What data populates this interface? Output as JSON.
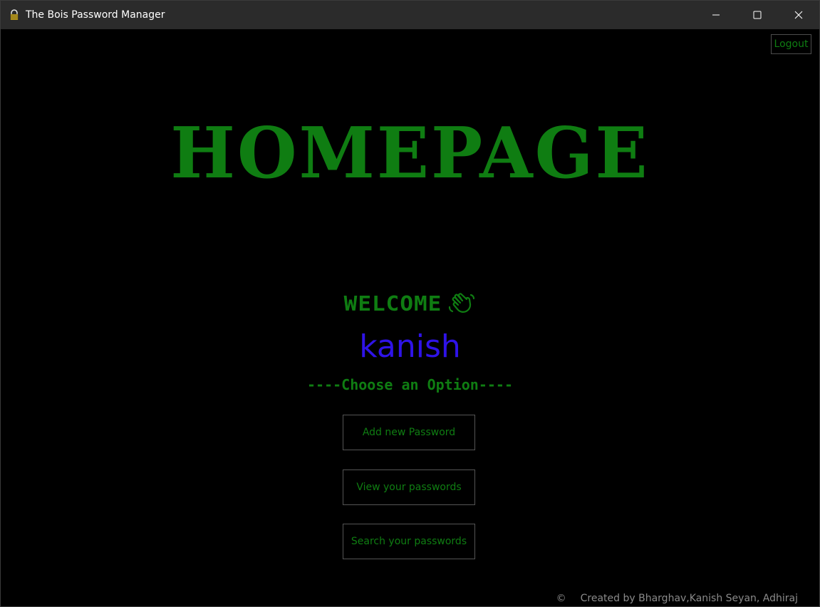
{
  "window": {
    "title": "The Bois Password Manager",
    "icon": "lock-icon"
  },
  "header": {
    "logout_label": "Logout"
  },
  "main": {
    "heading": "HOMEPAGE",
    "welcome_label": "WELCOME",
    "wave_icon": "waving-hand-icon",
    "username": "kanish",
    "choose_text": "----Choose an Option----",
    "buttons": [
      {
        "label": "Add new Password"
      },
      {
        "label": "View your passwords"
      },
      {
        "label": "Search your passwords"
      }
    ]
  },
  "footer": {
    "copyright_symbol": "©",
    "credits": "Created by Bharghav,Kanish Seyan, Adhiraj"
  },
  "colors": {
    "background": "#000000",
    "accent_green": "#0f7d12",
    "username_blue": "#2f13e8",
    "titlebar": "#2b2b2b"
  }
}
